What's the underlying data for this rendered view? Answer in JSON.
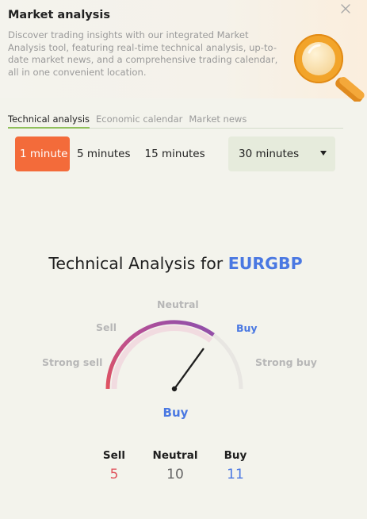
{
  "header": {
    "title": "Market analysis",
    "description": "Discover trading insights with our integrated Market Analysis tool, featuring real-time technical analysis, up-to-date market news, and a comprehensive trading calendar, all in one convenient location."
  },
  "icons": {
    "close": "close-icon",
    "illustration": "magnifier-icon",
    "caret": "caret-down-icon"
  },
  "tabs": [
    {
      "label": "Technical analysis",
      "active": true
    },
    {
      "label": "Economic calendar",
      "active": false
    },
    {
      "label": "Market news",
      "active": false
    }
  ],
  "intervals": [
    {
      "label": "1 minute",
      "active": true
    },
    {
      "label": "5 minutes",
      "active": false
    },
    {
      "label": "15 minutes",
      "active": false
    }
  ],
  "interval_dropdown": {
    "selected": "30 minutes"
  },
  "analysis": {
    "title_prefix": "Technical Analysis for",
    "symbol": "EURGBP",
    "gauge_labels": {
      "strong_sell": "Strong sell",
      "sell": "Sell",
      "neutral": "Neutral",
      "buy": "Buy",
      "strong_buy": "Strong buy"
    },
    "verdict": "Buy",
    "needle_fraction": 0.7,
    "summary": {
      "sell": {
        "label": "Sell",
        "value": "5"
      },
      "neutral": {
        "label": "Neutral",
        "value": "10"
      },
      "buy": {
        "label": "Buy",
        "value": "11"
      }
    }
  },
  "colors": {
    "accent": "#f36b3a",
    "sell": "#e0545e",
    "buy": "#4a78e2",
    "neutral_arc": "#8e4fa7"
  }
}
